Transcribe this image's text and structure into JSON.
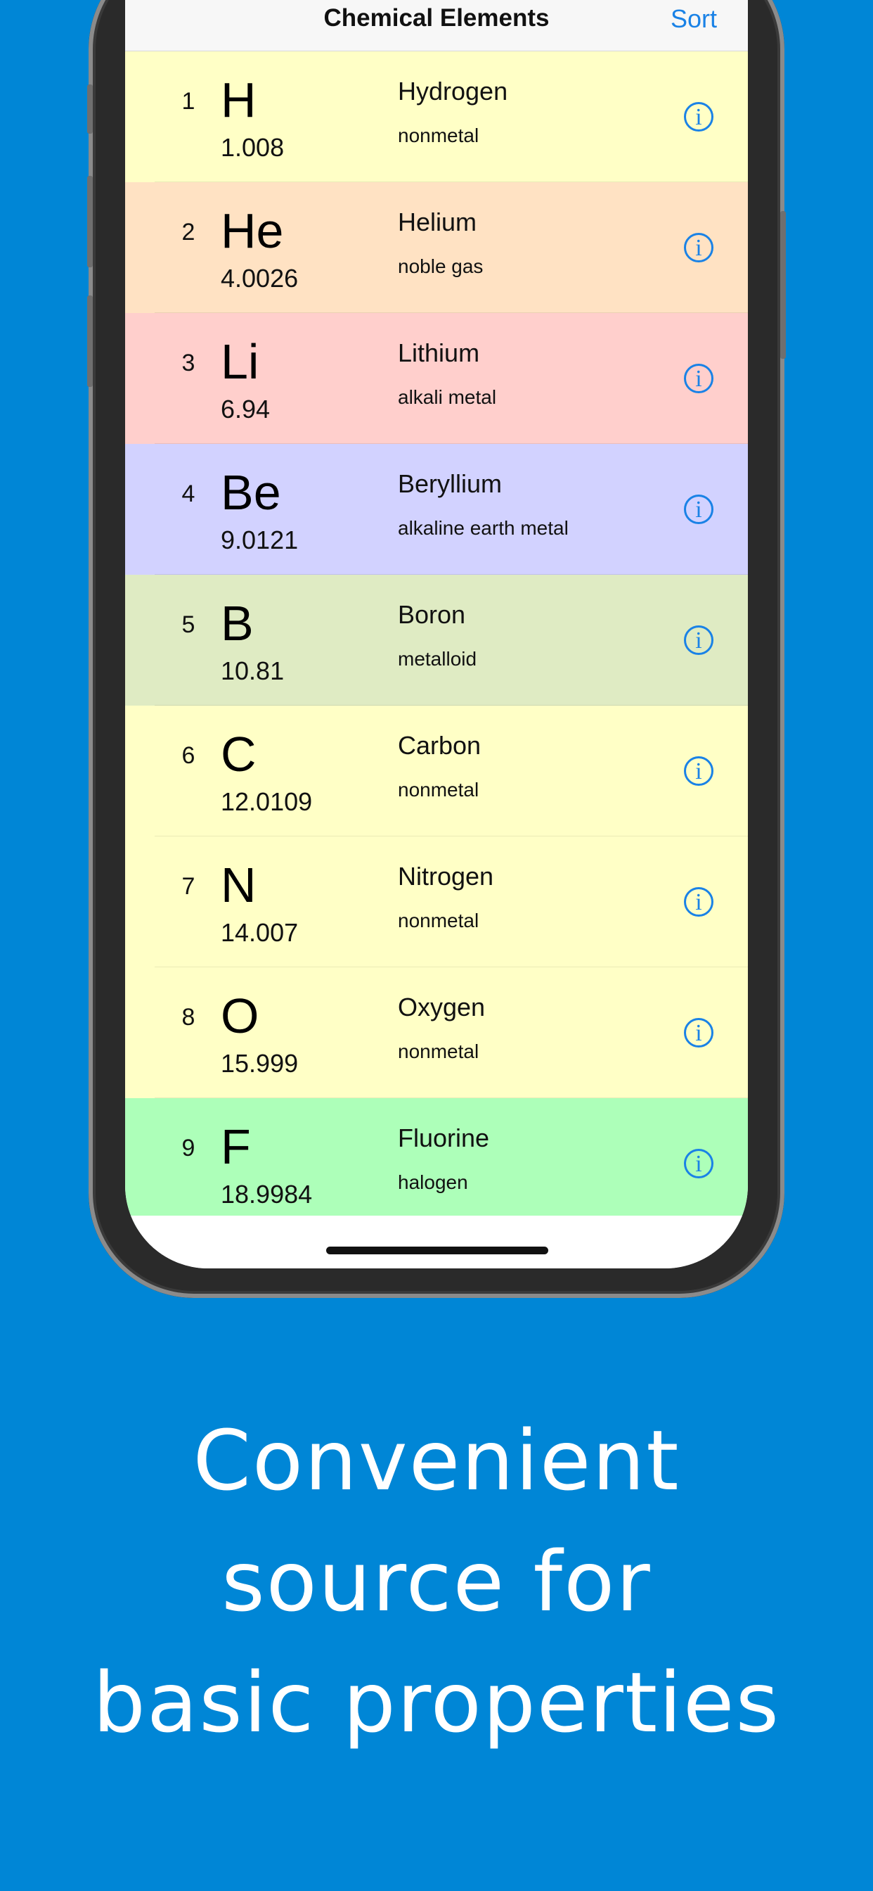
{
  "navbar": {
    "title": "Chemical Elements",
    "sort_label": "Sort"
  },
  "elements": [
    {
      "number": "1",
      "symbol": "H",
      "mass": "1.008",
      "name": "Hydrogen",
      "category": "nonmetal",
      "color": "#ffffc6"
    },
    {
      "number": "2",
      "symbol": "He",
      "mass": "4.0026",
      "name": "Helium",
      "category": "noble gas",
      "color": "#ffe2c3"
    },
    {
      "number": "3",
      "symbol": "Li",
      "mass": "6.94",
      "name": "Lithium",
      "category": "alkali metal",
      "color": "#ffcfcc"
    },
    {
      "number": "4",
      "symbol": "Be",
      "mass": "9.0121",
      "name": "Beryllium",
      "category": "alkaline earth metal",
      "color": "#d2d2ff"
    },
    {
      "number": "5",
      "symbol": "B",
      "mass": "10.81",
      "name": "Boron",
      "category": "metalloid",
      "color": "#dfebc3"
    },
    {
      "number": "6",
      "symbol": "C",
      "mass": "12.0109",
      "name": "Carbon",
      "category": "nonmetal",
      "color": "#ffffc6"
    },
    {
      "number": "7",
      "symbol": "N",
      "mass": "14.007",
      "name": "Nitrogen",
      "category": "nonmetal",
      "color": "#ffffc6"
    },
    {
      "number": "8",
      "symbol": "O",
      "mass": "15.999",
      "name": "Oxygen",
      "category": "nonmetal",
      "color": "#ffffc6"
    },
    {
      "number": "9",
      "symbol": "F",
      "mass": "18.9984",
      "name": "Fluorine",
      "category": "halogen",
      "color": "#adffb9"
    }
  ],
  "icons": {
    "info": "info-circle-icon",
    "info_glyph": "i"
  },
  "caption": {
    "lines": [
      "Convenient",
      "source for",
      "basic properties"
    ]
  },
  "colors": {
    "background": "#0086d6",
    "accent": "#1a82e6"
  }
}
